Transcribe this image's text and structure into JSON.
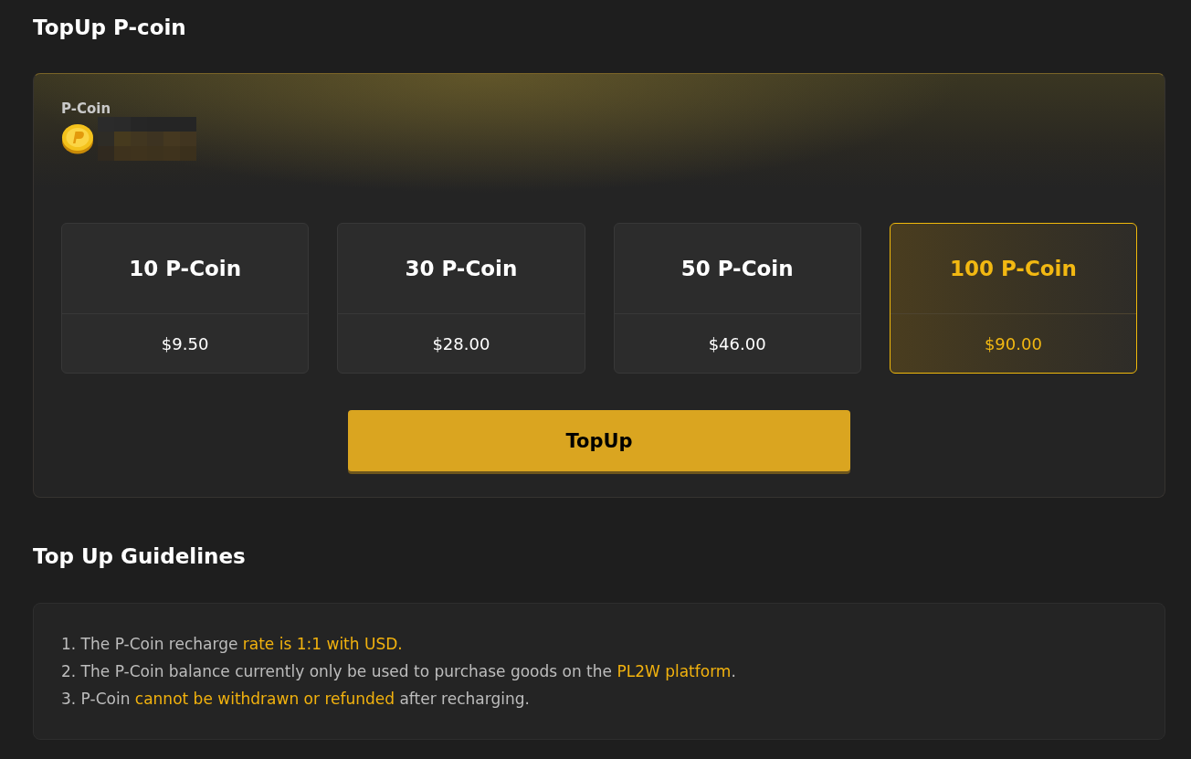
{
  "page_title": "TopUp P-coin",
  "balance_card": {
    "label": "P-Coin"
  },
  "packages": [
    {
      "amount": "10 P-Coin",
      "price": "$9.50",
      "selected": false
    },
    {
      "amount": "30 P-Coin",
      "price": "$28.00",
      "selected": false
    },
    {
      "amount": "50 P-Coin",
      "price": "$46.00",
      "selected": false
    },
    {
      "amount": "100 P-Coin",
      "price": "$90.00",
      "selected": true
    }
  ],
  "topup_button": "TopUp",
  "guidelines": {
    "title": "Top Up Guidelines",
    "items": [
      {
        "segments": [
          {
            "text": "1. The P-Coin recharge ",
            "highlight": false
          },
          {
            "text": "rate is 1:1 with USD.",
            "highlight": true
          }
        ]
      },
      {
        "segments": [
          {
            "text": "2. The P-Coin balance currently only be used to purchase goods on the ",
            "highlight": false
          },
          {
            "text": "PL2W platform",
            "highlight": true
          },
          {
            "text": ".",
            "highlight": false
          }
        ]
      },
      {
        "segments": [
          {
            "text": "3. P-Coin ",
            "highlight": false
          },
          {
            "text": "cannot be withdrawn or refunded",
            "highlight": true
          },
          {
            "text": " after recharging.",
            "highlight": false
          }
        ]
      }
    ]
  }
}
